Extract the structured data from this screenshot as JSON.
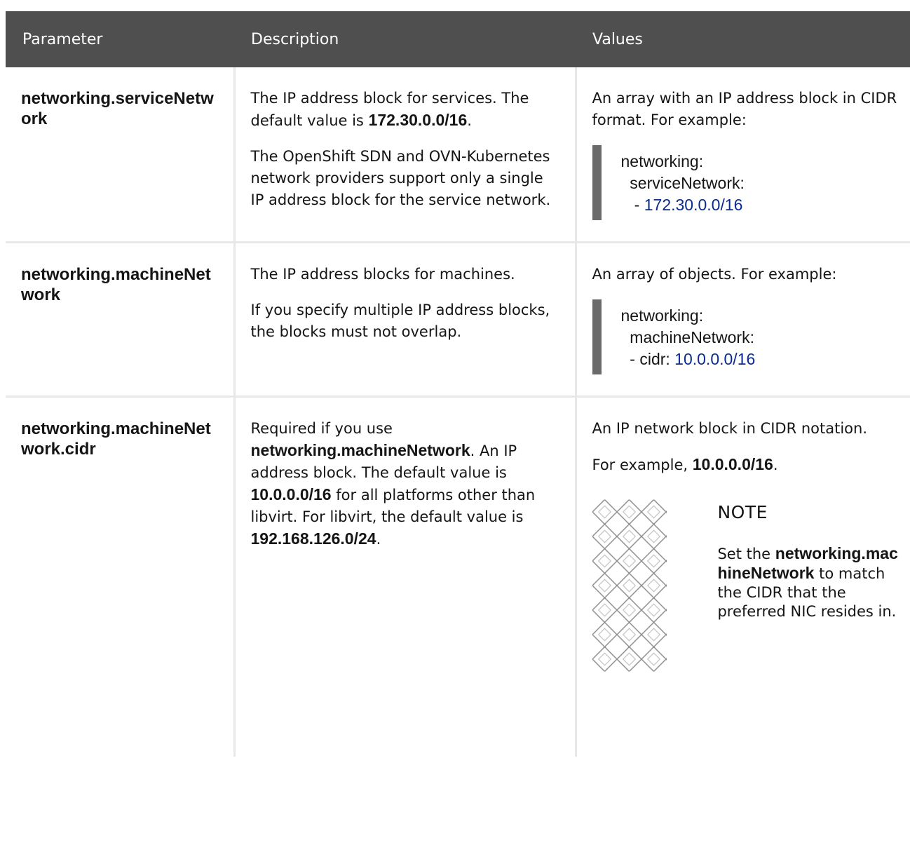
{
  "headers": {
    "parameter": "Parameter",
    "description": "Description",
    "values": "Values"
  },
  "rows": [
    {
      "param": "networking.serviceNetwork",
      "desc1_a": "The IP address block for services. The default value is ",
      "desc1_b": "172.30.0.0/16",
      "desc1_c": ".",
      "desc2": "The OpenShift SDN and OVN-Kubernetes network providers support only a single IP address block for the service network.",
      "value_text": "An array with an IP address block in CIDR format. For example:",
      "code_l1": "networking:",
      "code_l2": "  serviceNetwork:",
      "code_l3_prefix": "   - ",
      "code_l3_num": "172.30.0.0/16"
    },
    {
      "param": "networking.machineNetwork",
      "desc1": "The IP address blocks for machines.",
      "desc2": "If you specify multiple IP address blocks, the blocks must not overlap.",
      "value_text": "An array of objects. For example:",
      "code_l1": "networking:",
      "code_l2": "  machineNetwork:",
      "code_l3_prefix": "  - cidr: ",
      "code_l3_num": "10.0.0.0/16"
    },
    {
      "param": "networking.machineNetwork.cidr",
      "desc_a": "Required if you use ",
      "desc_b": "networking.machineNetwork",
      "desc_c": ". An IP address block. The default value is ",
      "desc_d": "10.0.0.0/16",
      "desc_e": " for all platforms other than libvirt. For libvirt, the default value is ",
      "desc_f": "192.168.126.0/24",
      "desc_g": ".",
      "value_text": "An IP network block in CIDR notation.",
      "example_a": "For example, ",
      "example_b": "10.0.0.0/16",
      "example_c": ".",
      "note_title": "NOTE",
      "note_a": "Set the ",
      "note_b": "networking.machineNetwork",
      "note_c": " to match the CIDR that the preferred NIC resides in."
    }
  ]
}
